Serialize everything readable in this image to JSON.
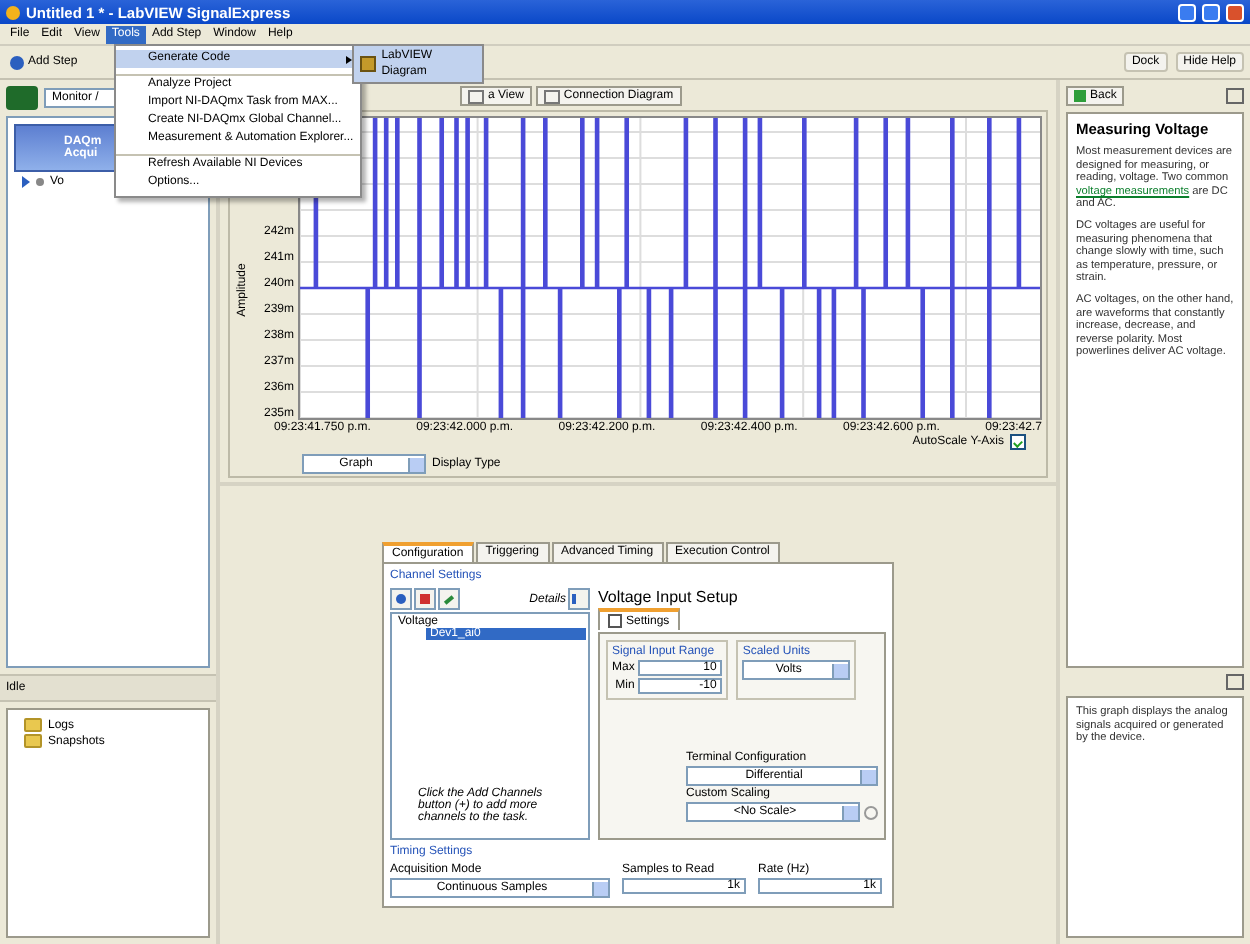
{
  "window": {
    "title": "Untitled 1 * - LabVIEW SignalExpress"
  },
  "menu_bar": [
    {
      "label": "File",
      "selected": false
    },
    {
      "label": "Edit",
      "selected": false
    },
    {
      "label": "View",
      "selected": false
    },
    {
      "label": "Tools",
      "selected": true
    },
    {
      "label": "Add Step",
      "selected": false
    },
    {
      "label": "Window",
      "selected": false
    },
    {
      "label": "Help",
      "selected": false
    }
  ],
  "tools_menu": {
    "items": [
      {
        "label": "Generate Code",
        "selected": true,
        "separator_before": false,
        "submenu": "LabVIEW Diagram"
      },
      {
        "label": "Analyze Project",
        "selected": false,
        "separator_before": true
      },
      {
        "label": "Import NI-DAQmx Task from MAX...",
        "selected": false,
        "separator_before": false
      },
      {
        "label": "Create NI-DAQmx Global Channel...",
        "selected": false,
        "separator_before": false
      },
      {
        "label": "Measurement & Automation Explorer...",
        "selected": false,
        "separator_before": false
      },
      {
        "label": "Refresh Available NI Devices",
        "selected": false,
        "separator_before": true
      },
      {
        "label": "Options...",
        "selected": false,
        "separator_before": false
      }
    ]
  },
  "toolbar": {
    "add_step": "Add Step",
    "dock": "Dock",
    "hide_help": "Hide Help"
  },
  "steps_pane": {
    "view_selector": "Monitor /",
    "step_lines": [
      "DAQm",
      "Acqui"
    ],
    "step_row": "Vo"
  },
  "status": "Idle",
  "logs_tree": [
    {
      "label": "Logs"
    },
    {
      "label": "Snapshots"
    }
  ],
  "view_tabs": [
    {
      "label": "a View",
      "selected": false
    },
    {
      "label": "Connection Diagram",
      "selected": false
    }
  ],
  "graph": {
    "y_axis_label": "Amplitude",
    "y_ticks": [
      "242m",
      "241m",
      "240m",
      "239m",
      "238m",
      "237m",
      "236m",
      "235m"
    ],
    "x_ticks": [
      "09:23:41.750 p.m.",
      "09:23:42.000 p.m.",
      "09:23:42.200 p.m.",
      "09:23:42.400 p.m.",
      "09:23:42.600 p.m.",
      "09:23:42.7"
    ],
    "autoscale": {
      "label": "AutoScale Y-Axis",
      "checked": true
    },
    "display_type": {
      "value": "Graph",
      "label": "Display Type"
    }
  },
  "config": {
    "tabs": [
      {
        "label": "Configuration",
        "selected": true
      },
      {
        "label": "Triggering",
        "selected": false
      },
      {
        "label": "Advanced Timing",
        "selected": false
      },
      {
        "label": "Execution Control",
        "selected": false
      }
    ],
    "channel_settings": "Channel Settings",
    "details": "Details",
    "channels": [
      {
        "label": "Voltage",
        "selected": false,
        "children": [
          {
            "label": "Dev1_ai0",
            "selected": true
          }
        ]
      }
    ],
    "hint": "Click the Add Channels button (+) to add more channels to the task.",
    "setup_title": "Voltage Input Setup",
    "setup_tab": "Settings",
    "signal_input_range": "Signal Input Range",
    "max_label": "Max",
    "max": "10",
    "min_label": "Min",
    "min": "-10",
    "scaled_units_label": "Scaled Units",
    "scaled_units": "Volts",
    "terminal_label": "Terminal Configuration",
    "terminal": "Differential",
    "scaling_label": "Custom Scaling",
    "scaling": "<No Scale>",
    "timing_settings": "Timing Settings",
    "acq_mode_label": "Acquisition Mode",
    "acq_mode": "Continuous Samples",
    "samples_label": "Samples to Read",
    "samples": "1k",
    "rate_label": "Rate (Hz)",
    "rate": "1k"
  },
  "help": {
    "back": "Back",
    "title": "Measuring Voltage",
    "intro": {
      "before": "Most measurement devices are designed for measuring, or reading, voltage. Two common ",
      "link": "voltage measurements",
      "after": " are DC and AC."
    },
    "paragraphs": [
      "DC voltages are useful for measuring phenomena that change slowly with time, such as temperature, pressure, or strain.",
      "AC voltages, on the other hand, are waveforms that constantly increase, decrease, and reverse polarity. Most powerlines deliver AC voltage."
    ],
    "graph_help": "This graph displays the analog signals acquired or generated by the device."
  }
}
